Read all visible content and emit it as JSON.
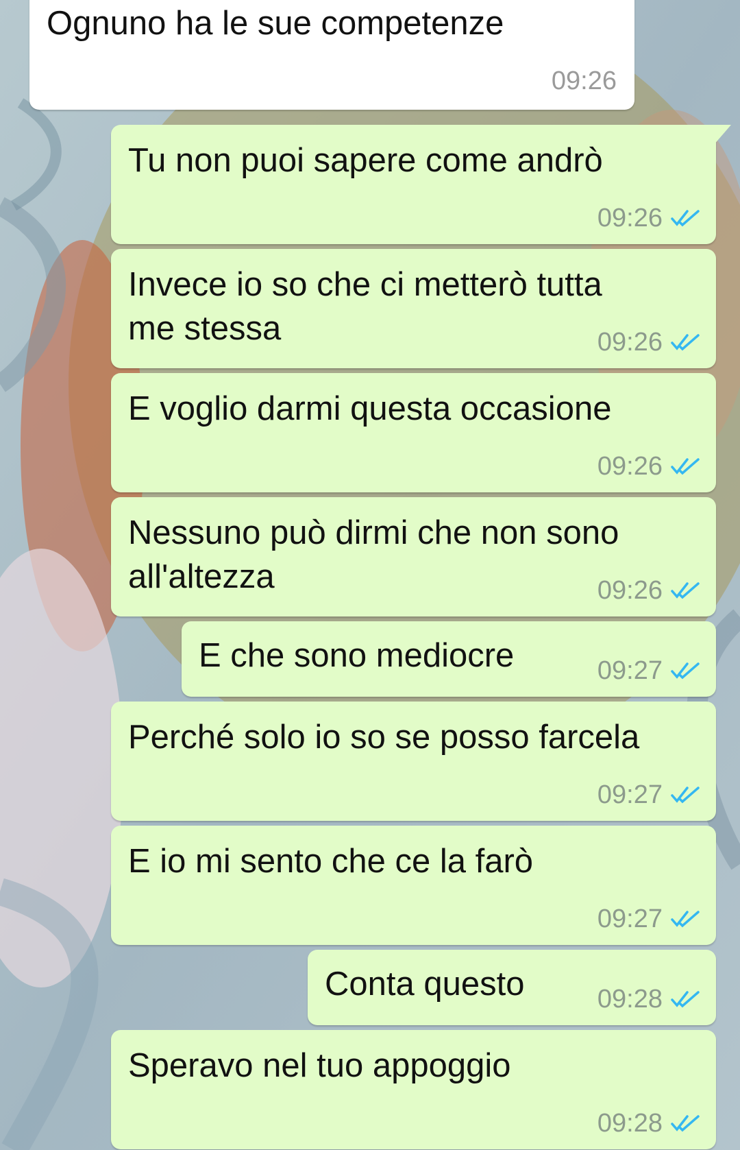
{
  "messages": [
    {
      "text": "Ognuno ha le sue competenze",
      "time": "09:26",
      "direction": "incoming"
    },
    {
      "text": "Tu non puoi sapere come andrò",
      "time": "09:26",
      "direction": "outgoing",
      "status_icon": "double-check-read-icon"
    },
    {
      "text": "Invece io so che ci metterò tutta\nme stessa",
      "time": "09:26",
      "direction": "outgoing",
      "status_icon": "double-check-read-icon"
    },
    {
      "text": "E voglio darmi questa occasione",
      "time": "09:26",
      "direction": "outgoing",
      "status_icon": "double-check-read-icon"
    },
    {
      "text": "Nessuno può dirmi che non sono\nall'altezza",
      "time": "09:26",
      "direction": "outgoing",
      "status_icon": "double-check-read-icon"
    },
    {
      "text": "E che sono mediocre",
      "time": "09:27",
      "direction": "outgoing",
      "status_icon": "double-check-read-icon"
    },
    {
      "text": "Perché solo io so se posso farcela",
      "time": "09:27",
      "direction": "outgoing",
      "status_icon": "double-check-read-icon"
    },
    {
      "text": "E io mi sento che ce la farò",
      "time": "09:27",
      "direction": "outgoing",
      "status_icon": "double-check-read-icon"
    },
    {
      "text": "Conta questo",
      "time": "09:28",
      "direction": "outgoing",
      "status_icon": "double-check-read-icon"
    },
    {
      "text": "Speravo nel tuo appoggio",
      "time": "09:28",
      "direction": "outgoing",
      "status_icon": "double-check-read-icon"
    }
  ],
  "colors": {
    "incoming_bubble": "#ffffff",
    "outgoing_bubble": "#e2fcc8",
    "read_ticks": "#34b7f1",
    "timestamp": "#8c9a8c"
  }
}
